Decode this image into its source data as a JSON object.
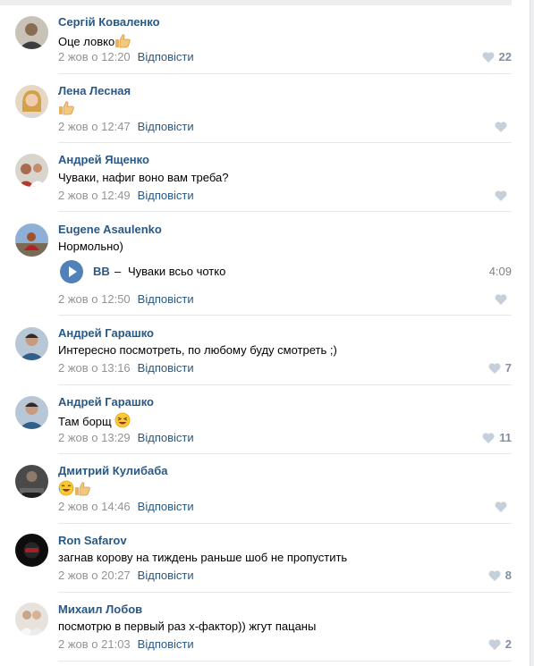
{
  "reply_label": "Відповісти",
  "accent_color": "#2a5885",
  "comments": [
    {
      "author": "Сергій Коваленко",
      "text": "Оце ловко",
      "emoji": [
        "thumbs-up"
      ],
      "date": "2 жов о 12:20",
      "likes": "22"
    },
    {
      "author": "Лена Лесная",
      "text": "",
      "emoji": [
        "thumbs-up"
      ],
      "date": "2 жов о 12:47",
      "likes": ""
    },
    {
      "author": "Андрей Ященко",
      "text": "Чуваки, нафиг воно вам треба?",
      "emoji": [],
      "date": "2 жов о 12:49",
      "likes": ""
    },
    {
      "author": "Eugene Asaulenko",
      "text": "Нормольно)",
      "emoji": [],
      "date": "2 жов о 12:50",
      "likes": "",
      "audio": {
        "artist": "BB",
        "separator": "–",
        "title": "Чуваки всьо чотко",
        "duration": "4:09"
      }
    },
    {
      "author": "Андрей Гарашко",
      "text": "Интересно посмотреть, по любому буду смотреть ;)",
      "emoji": [],
      "date": "2 жов о 13:16",
      "likes": "7"
    },
    {
      "author": "Андрей Гарашко",
      "text": "Там борщ",
      "emoji": [
        "laughing-face"
      ],
      "date": "2 жов о 13:29",
      "likes": "11"
    },
    {
      "author": "Дмитрий Кулибаба",
      "text": "",
      "emoji": [
        "tears-of-joy",
        "thumbs-up"
      ],
      "date": "2 жов о 14:46",
      "likes": ""
    },
    {
      "author": "Ron Safarov",
      "text": "загнав корову на тиждень раньше шоб не пропустить",
      "emoji": [],
      "date": "2 жов о 20:27",
      "likes": "8"
    },
    {
      "author": "Михаил Лобов",
      "text": "посмотрю в первый раз х-фактор)) жгут пацаны",
      "emoji": [],
      "date": "2 жов о 21:03",
      "likes": "2"
    }
  ]
}
